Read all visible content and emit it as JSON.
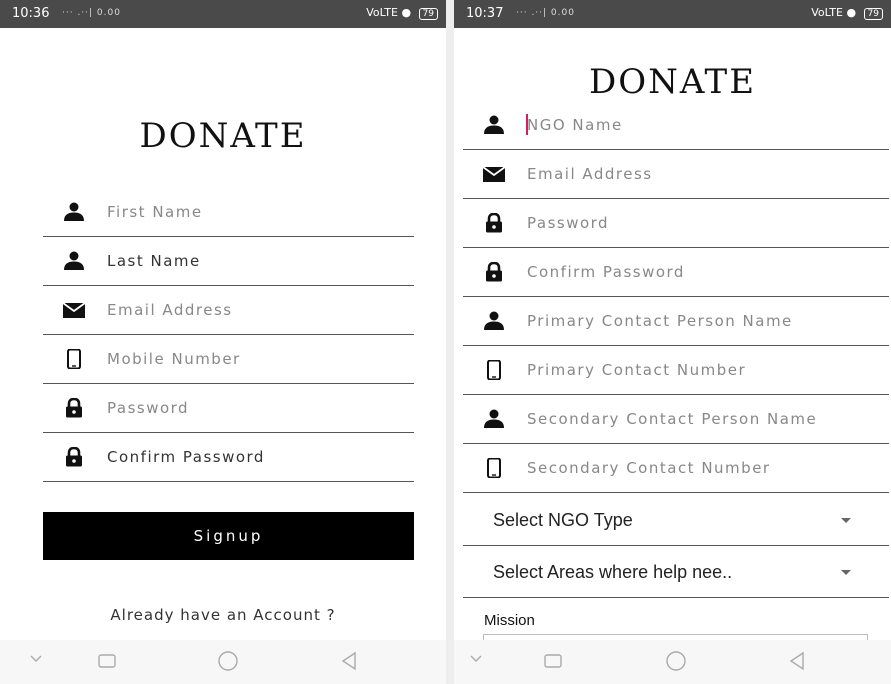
{
  "colors": {
    "status_bar": "#4a4a4a",
    "signup_button": "#000000",
    "cursor": "#d81b60",
    "underline": "#555555"
  },
  "left": {
    "status": {
      "time": "10:36",
      "signal": "‧‧‧ .‧‧| 0.00",
      "indicators": "VoLTE",
      "battery": "79"
    },
    "brand": "DONATE",
    "fields": [
      {
        "icon": "person-icon",
        "label": "First Name"
      },
      {
        "icon": "person-icon",
        "label": "Last Name"
      },
      {
        "icon": "mail-icon",
        "label": "Email Address"
      },
      {
        "icon": "phone-icon",
        "label": "Mobile Number"
      },
      {
        "icon": "lock-icon",
        "label": "Password"
      },
      {
        "icon": "lock-icon",
        "label": "Confirm Password"
      }
    ],
    "signup_label": "Signup",
    "account_link": "Already have an Account ?"
  },
  "right": {
    "status": {
      "time": "10:37",
      "signal": "‧‧‧ .‧‧| 0.00",
      "indicators": "VoLTE",
      "battery": "79"
    },
    "brand": "DONATE",
    "fields": [
      {
        "icon": "person-icon",
        "label": "NGO Name"
      },
      {
        "icon": "mail-icon",
        "label": "Email Address"
      },
      {
        "icon": "lock-icon",
        "label": "Password"
      },
      {
        "icon": "lock-icon",
        "label": "Confirm Password"
      },
      {
        "icon": "person-icon",
        "label": "Primary Contact Person Name"
      },
      {
        "icon": "phone-icon",
        "label": "Primary Contact Number"
      },
      {
        "icon": "person-icon",
        "label": "Secondary Contact Person Name"
      },
      {
        "icon": "phone-icon",
        "label": "Secondary Contact Number"
      }
    ],
    "selects": [
      {
        "label": "Select NGO Type"
      },
      {
        "label": "Select Areas where help nee.."
      }
    ],
    "mission_label": "Mission"
  },
  "nav": {
    "back": "back-icon",
    "home": "home-icon",
    "recents": "recents-icon",
    "menu": "chevron-down-icon"
  }
}
